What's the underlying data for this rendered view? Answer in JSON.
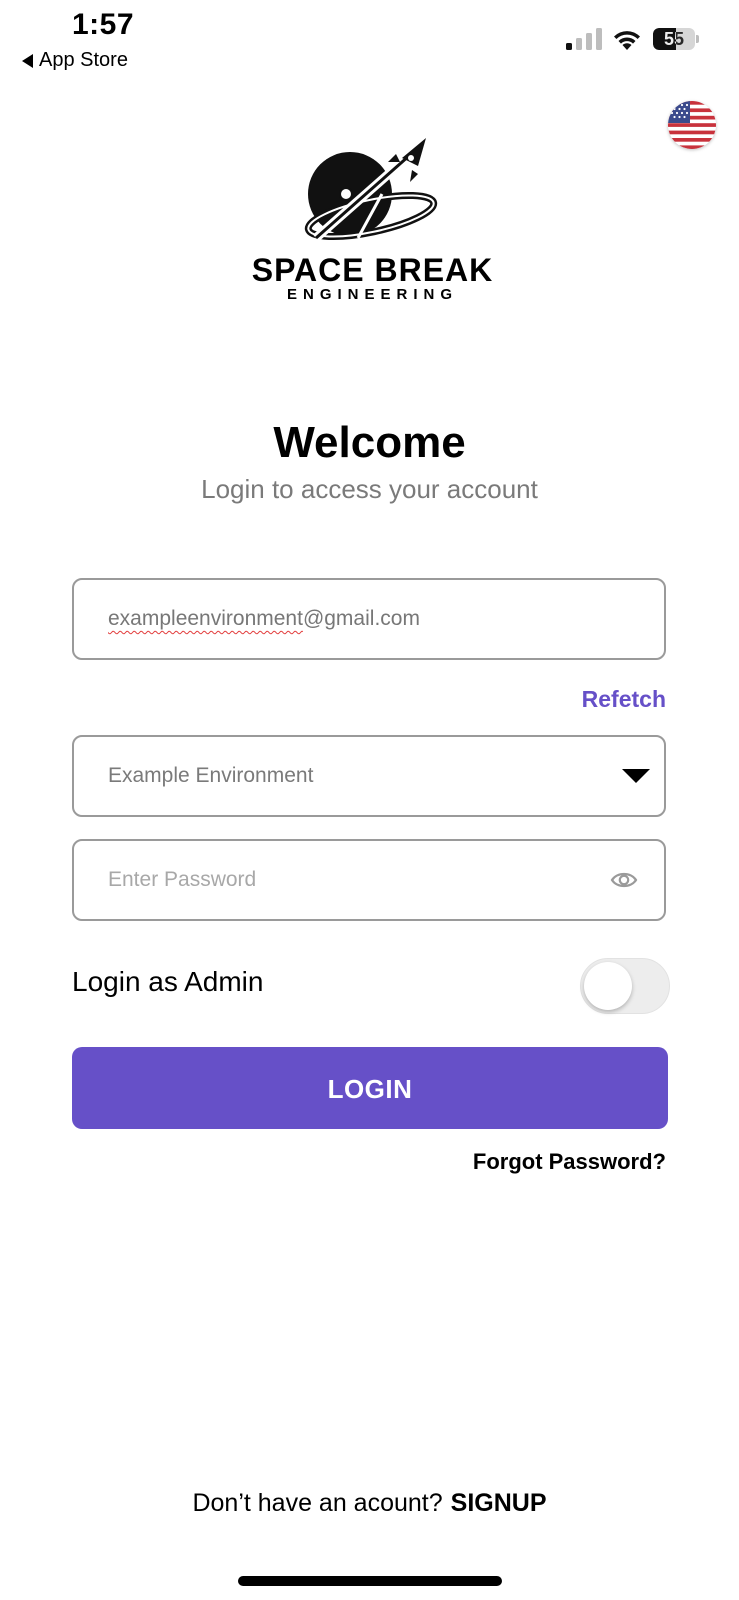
{
  "status_bar": {
    "time": "1:57",
    "back_label": "App Store",
    "battery_level": "55"
  },
  "logo": {
    "title": "SPACE BREAK",
    "subtitle": "ENGINEERING"
  },
  "header": {
    "title": "Welcome",
    "subtitle": "Login to access your account"
  },
  "form": {
    "email_spelled": "exampleenvironment",
    "email_domain": "@gmail.com",
    "refetch_label": "Refetch",
    "environment_value": "Example Environment",
    "password_placeholder": "Enter Password",
    "admin_label": "Login as Admin",
    "admin_toggle_on": false,
    "login_label": "LOGIN",
    "forgot_label": "Forgot Password?"
  },
  "footer": {
    "question": "Don’t have an acount?",
    "signup_label": "SIGNUP"
  },
  "colors": {
    "accent": "#6650c8",
    "border": "#9a9a9a",
    "toggle_off": "#ededed"
  }
}
